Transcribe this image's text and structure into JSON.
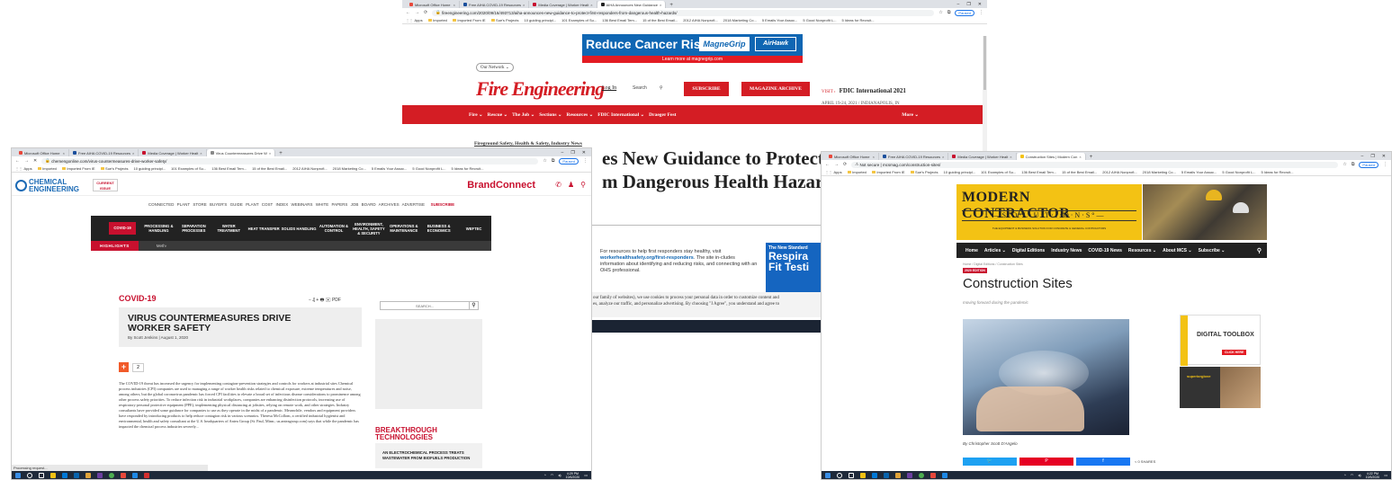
{
  "screenshots": {
    "fire": {
      "tabs": [
        {
          "label": "Microsoft Office Home",
          "color": "#e8483b"
        },
        {
          "label": "Free AIHA COVID-19 Resources",
          "color": "#1b4f9c"
        },
        {
          "label": "Media Coverage | Worker Healt",
          "color": "#c8102e"
        },
        {
          "label": "AIHA Announces New Guidance",
          "color": "#222222"
        }
      ],
      "url": "fireengineering.com/2020/09/16/493713/aiha-announces-new-guidance-to-protect-first-responders-from-dangerous-health-hazards/",
      "paused_label": "Paused",
      "bookmarks": [
        "Apps",
        "Imported",
        "Imported From IE",
        "Sue's Projects",
        "10 guiding principl...",
        "101 Examples of Su...",
        "136 Best Email Tem...",
        "15 of the Best Email...",
        "2012 AIHA Nonprofi...",
        "2018 Marketing Co...",
        "5 Emails Your Assoc...",
        "5 Good Nonprofit L...",
        "5 Ideas for Recruit..."
      ],
      "ad": {
        "headline": "Reduce Cancer Risk",
        "brand": "MagneGrip",
        "brand2": "AirHawk",
        "strip": "Learn more at magnegrip.com"
      },
      "network_label": "Our Network ⌄",
      "logo": "Fire Engineering",
      "login": "Log In",
      "search_label": "Search",
      "subscribe": "SUBSCRIBE",
      "archive": "MAGAZINE ARCHIVE",
      "event": {
        "visit": "VISIT ›",
        "name": "FDIC International 2021",
        "date": "APRIL 19-24, 2021  /  INDIANAPOLIS, IN"
      },
      "nav": [
        "Fire ⌄",
        "Rescue ⌄",
        "The Job ⌄",
        "Sections ⌄",
        "Resources ⌄",
        "FDIC International ⌄",
        "Draeger Fest"
      ],
      "nav_more": "More ⌄",
      "kicker": "Fireground Safety, Health & Safety, Industry News",
      "headline_1": "es New Guidance to Protect Fir",
      "headline_2": "m Dangerous Health Hazards",
      "resource_text_1": "For resources to help first responders stay healthy, visit",
      "resource_link": "workerhealthsafety.org/first-responders",
      "resource_text_2": ". The site in-cludes information about identifying and reducing risks, and connecting with an OHS professional.",
      "ad2_line1": "The New Standard",
      "ad2_line2": "Respira",
      "ad2_line3": "Fit Testi",
      "cookie_1": "our family of websites), we use cookies to process your personal data in order to customize content and",
      "cookie_2": "es, analyze our traffic, and personalize advertising. By choosing \"I Agree\", you understand and agree to"
    },
    "chem": {
      "tabs": [
        {
          "label": "Microsoft Office Home",
          "color": "#e8483b"
        },
        {
          "label": "Free AIHA COVID-19 Resources",
          "color": "#1b4f9c"
        },
        {
          "label": "Media Coverage | Worker Healt",
          "color": "#c8102e"
        },
        {
          "label": "Virus Countermeasures Drive W",
          "color": "#888888"
        }
      ],
      "url": "chemengonline.com/virus-countermeasures-drive-worker-safety/",
      "paused_label": "Paused",
      "bookmarks": [
        "Apps",
        "Imported",
        "Imported From IE",
        "Sue's Projects",
        "10 guiding principl...",
        "101 Examples of Su...",
        "136 Best Email Tem...",
        "15 of the Best Email...",
        "2012 AIHA Nonprofi...",
        "2018 Marketing Co...",
        "5 Emails Your Assoc...",
        "5 Good Nonprofit L...",
        "5 Ideas for Recruit..."
      ],
      "logo_1": "CHEMICAL",
      "logo_2": "ENGINEERING",
      "issue_1": "CURRENT",
      "issue_2": "ISSUE",
      "brandconnect": "BrandConnect",
      "subnav": "CONNECTED PLANT   STORE   BUYER'S GUIDE   PLANT COST INDEX   WEBINARS   WHITE PAPERS   JOB BOARD   ARCHIVES   ADVERTISE",
      "subnav_subscribe": "SUBSCRIBE",
      "mainnav_covid": "COVID-19",
      "mainnav": [
        "PROCESSING & HANDLING",
        "SEPARATION PROCESSES",
        "WATER TREATMENT",
        "HEAT TRANSFER",
        "SOLIDS HANDLING",
        "AUTOMATION & CONTROL",
        "ENVIRONMENT, HEALTH, SAFETY & SECURITY",
        "OPERATIONS & MAINTENANCE",
        "BUSINESS & ECONOMICS",
        "WEFTEC"
      ],
      "highlights": "HIGHLIGHTS",
      "highlight_item": "Meth›",
      "category": "COVID-19",
      "tools": "− ₰ + 🖶 ✉ PDF",
      "title": "VIRUS COUNTERMEASURES DRIVE WORKER SAFETY",
      "byline": "By Scott Jenkins  |  August 1, 2020",
      "share_count": "2",
      "body": "The COVID-19 threat has increased the urgency for implementing contagion-prevention strategies and controls for workers at industrial sites Chemical process industries (CPI) companies are used to managing a range of worker health risks related to chemical exposure, extreme temperatures and noise, among others, but the global coronavirus pandemic has forced CPI facilities to elevate a broad set of infectious disease considerations to prominence among other process safety priorities. To reduce infection risk in industrial workplaces, companies are enhancing disinfection protocols, increasing use of respiratory personal protective equipment (PPE), implementing physical distancing at jobsites, relying on remote work, and other strategies. Industry consultants have provided some guidance for companies to use as they operate in the midst of a pandemic. Meanwhile, vendors and equipment providers have responded by introducing products to help reduce contagion risk in various scenarios. Theresa McCollom, a certified industrial hygienist and environmental, health and safety consultant at the U.S. headquarters of Antea Group (St. Paul, Minn.; us.anteagroup.com) says that while the pandemic has impacted the chemical process industries severely...",
      "search_placeholder": "SEARCH...",
      "breakthrough_1": "BREAKTHROUGH",
      "breakthrough_2": "TECHNOLOGIES",
      "card_text": "AN ELECTROCHEMICAL PROCESS TREATS WASTEWATER FROM BIOFUELS PRODUCTION",
      "status": "Processing request...",
      "time": "4:29 PM",
      "date": "10/6/2020"
    },
    "mcs": {
      "tabs": [
        {
          "label": "Microsoft Office Home",
          "color": "#e8483b"
        },
        {
          "label": "Free AIHA COVID-19 Resources",
          "color": "#1b4f9c"
        },
        {
          "label": "Media Coverage | Worker Healt",
          "color": "#c8102e"
        },
        {
          "label": "Construction Sites | Modern Con",
          "color": "#f3c214"
        }
      ],
      "url": "mcsmag.com/construction-sites/",
      "not_secure": "Not secure",
      "paused_label": "Paused",
      "bookmarks": [
        "Apps",
        "Imported",
        "Imported From IE",
        "Sue's Projects",
        "10 guiding principl...",
        "101 Examples of Su...",
        "136 Best Email Tem...",
        "15 of the Best Email...",
        "2012 AIHA Nonprofi...",
        "2018 Marketing Co...",
        "5 Emails Your Assoc...",
        "5 Good Nonprofit L...",
        "5 Ideas for Recruit..."
      ],
      "logo_1": "MODERN  CONTRACTOR",
      "logo_2": "—S·O·L·U·T·I·O·N·S°—",
      "logo_3": "THE EQUIPMENT & BUSINESS SOLUTION FOR CONCRETE & GENERAL CONTRACTORS",
      "nav": [
        "Home",
        "Articles ⌄",
        "Digital Editions",
        "Industry News",
        "COVID-19 News",
        "Resources ⌄",
        "About MCS ⌄",
        "Subscribe ⌄"
      ],
      "crumb": "Home  /  Digital Editions  /  Construction Sites",
      "badge": "2020 EDITION",
      "title": "Construction Sites",
      "subtitle": "moving forward during the pandemic",
      "byline": "By Christopher Scott D'Angelo",
      "share_twitter": "🐦",
      "share_pinterest": "P",
      "share_facebook": "f",
      "share_count": "< 0 SHARES",
      "ad1_title": "DIGITAL TOOLBOX",
      "ad1_cta": "CLICK HERE",
      "ad2_brand": "superiorglove",
      "time": "4:22 PM",
      "date": "10/5/2020"
    }
  }
}
